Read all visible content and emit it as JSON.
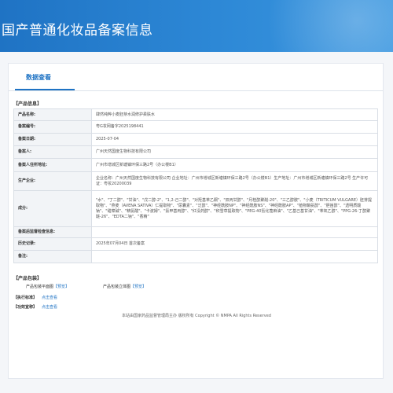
{
  "header": {
    "title": "国产普通化妆品备案信息"
  },
  "tabs": [
    {
      "label": "数据查看"
    }
  ],
  "sections": {
    "product_info": "【产品信息】",
    "product_package": "【产品包装】",
    "exec_standard": "【执行标准】",
    "efficacy": "【功效宣称】"
  },
  "info_rows": [
    {
      "label": "产品名称:",
      "value": "肆然纯粹小麦胚芽水润修护柔肤水"
    },
    {
      "label": "备案编号:",
      "value": "粤G妆网备字2025198441"
    },
    {
      "label": "备案日期:",
      "value": "2025-07-04"
    },
    {
      "label": "备案人:",
      "value": "广州天然国度生物科技有限公司"
    },
    {
      "label": "备案人住所地址:",
      "value": "广州市增城区新塘镇环保三路2号（办公楼B1）"
    },
    {
      "label": "生产企业:",
      "value": "企业名称：广州天然国度生物科技有限公司 企业地址：广州市增城区新塘镇环保三路2号（办公楼B1）生产地址：广州市增城区新塘镇环保三路2号 生产许可证：粤妆20200039"
    },
    {
      "label": "成分:",
      "value": "\"水\"、\"丁二醇\"、\"甘油\"、\"戊二醇-2\"、\"1,2-己二醇\"、\"对羟基苯乙酮\"、\"双丙甘醇\"、\"月桂醇聚醚-20\"、\"三乙醇胺\"、\"小麦（TRITICUM VULGARE）胚芽提取物\"、\"燕麦（AVENA SATIVA）仁提取物\"、\"尿囊素\"、\"泛醇\"、\"神经酰胺NP\"、\"神经酰胺NS\"、\"神经酰胺AP\"、\"植物鞘氨醇\"、\"胆甾醇\"、\"透明质酸钠\"、\"甜菜碱\"、\"精氨酸\"、\"卡波姆\"、\"氨甲基丙醇\"、\"红没药醇\"、\"积雪草提取物\"、\"PEG-40氢化蓖麻油\"、\"乙基己基甘油\"、\"苯氧乙醇\"、\"PPG-26-丁醇聚醚-26\"、\"EDTA二钠\"、\"香精\""
    },
    {
      "label": "备案后监督检查信息:",
      "value": ""
    },
    {
      "label": "历史记录:",
      "value": "2025年07月04日 首次备案"
    },
    {
      "label": "备注:",
      "value": ""
    }
  ],
  "package": {
    "flat_label": "产品包装平面图",
    "flat_view": "【预览】",
    "solid_label": "产品包装立体图",
    "solid_view": "【预览】"
  },
  "exec_standard_link": "点击查看",
  "efficacy_link": "点击查看",
  "footer": "本站由国家药品监督管理局主办 版权所有 Copyright © NMPA All Rights Reserved"
}
